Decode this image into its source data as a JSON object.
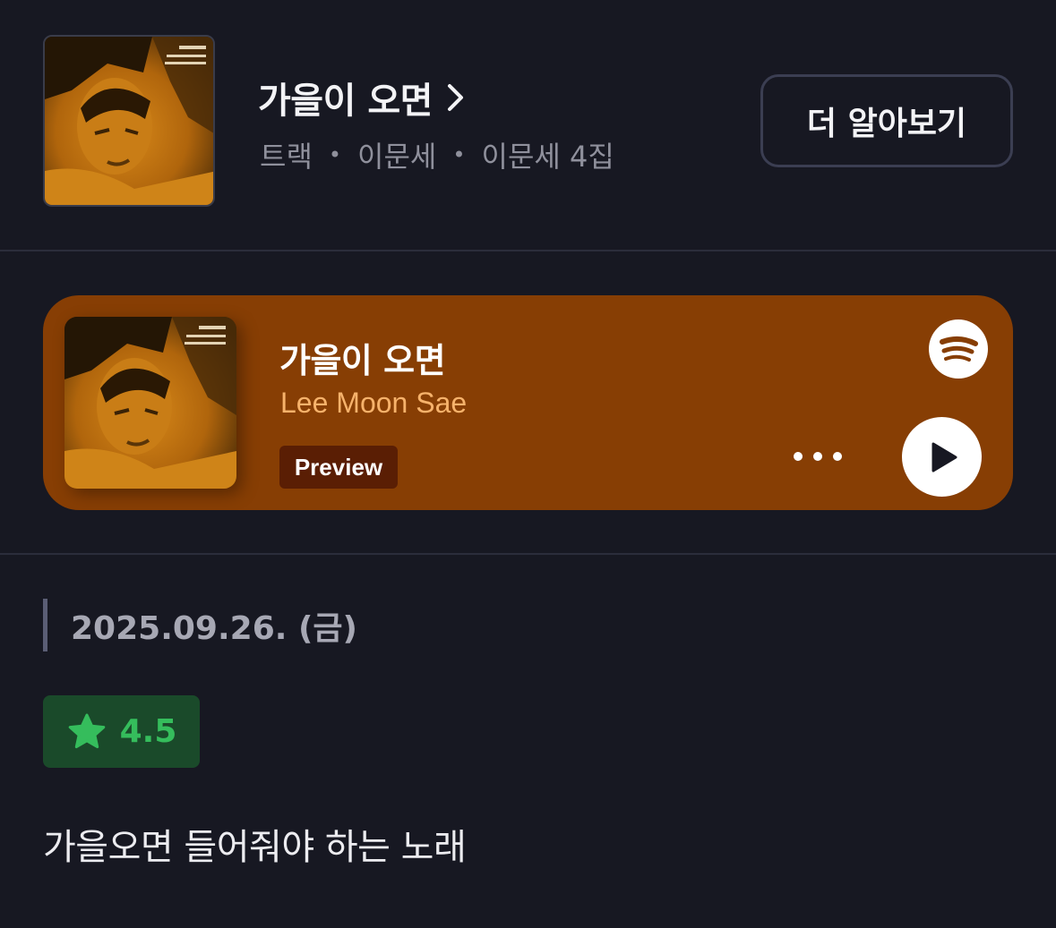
{
  "header": {
    "title": "가을이 오면",
    "meta": {
      "type": "트랙",
      "artist": "이문세",
      "album": "이문세 4집",
      "separator": "•"
    },
    "learn_more_label": "더 알아보기"
  },
  "player": {
    "title": "가을이 오면",
    "artist": "Lee Moon Sae",
    "badge": "Preview",
    "provider_icon": "spotify-icon",
    "more_icon": "more-dots-icon",
    "play_icon": "play-icon",
    "colors": {
      "card_bg": "#873e04",
      "artist_text": "#f6b26b",
      "badge_bg": "#5a1e04"
    }
  },
  "review": {
    "date": "2025.09.26. (금)",
    "rating": "4.5",
    "rating_icon": "star-icon",
    "text": "가을오면 들어줘야 하는 노래",
    "colors": {
      "rating_bg": "#1a4a2a",
      "rating_fg": "#35bd5c"
    }
  },
  "theme": {
    "background": "#171822",
    "divider": "#2b2d3b"
  }
}
